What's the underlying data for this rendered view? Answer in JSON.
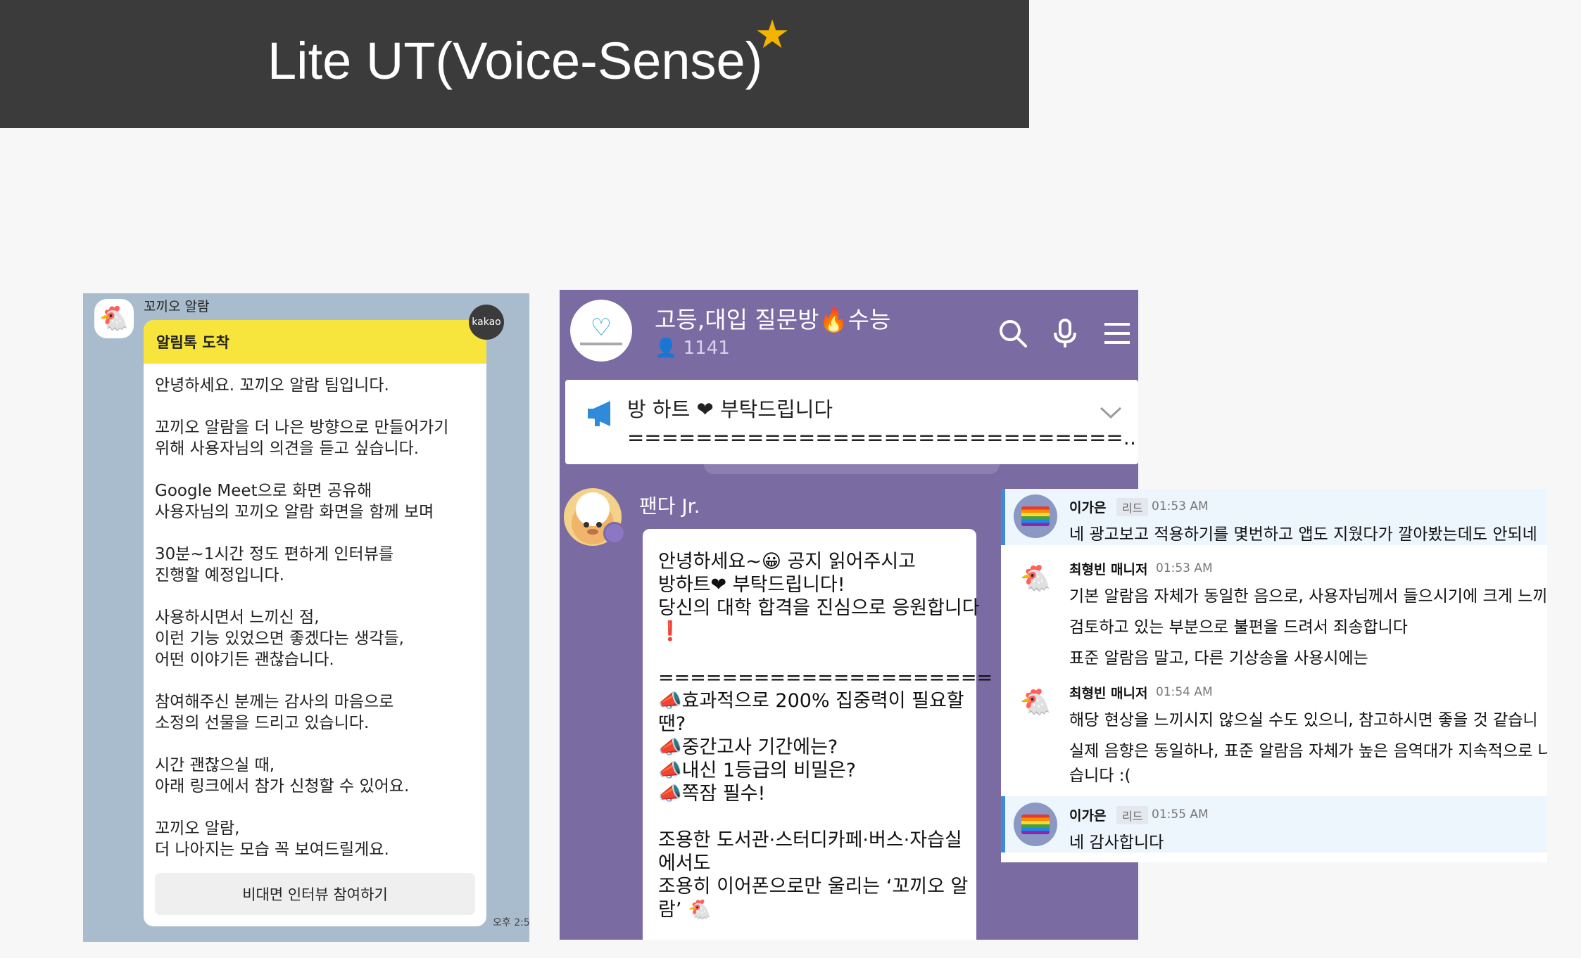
{
  "banner": {
    "title": "Lite UT(Voice-Sense)",
    "star": "★"
  },
  "kakao": {
    "sender": "꼬끼오 알람",
    "header": "알림톡 도착",
    "paragraphs": [
      [
        "안녕하세요. 꼬끼오 알람 팀입니다."
      ],
      [
        "꼬끼오 알람을 더 나은 방향으로 만들어가기",
        "위해 사용자님의 의견을 듣고 싶습니다."
      ],
      [
        "Google Meet으로 화면 공유해",
        "사용자님의 꼬끼오 알람 화면을 함께 보며"
      ],
      [
        "30분~1시간 정도 편하게 인터뷰를",
        "진행할 예정입니다."
      ],
      [
        "사용하시면서 느끼신 점,",
        "이런 기능 있었으면 좋겠다는 생각들,",
        "어떤 이야기든 괜찮습니다."
      ],
      [
        "참여해주신 분께는 감사의 마음으로",
        "소정의 선물을 드리고 있습니다."
      ],
      [
        "시간 괜찮으실 때,",
        "아래 링크에서 참가 신청할 수 있어요."
      ],
      [
        "꼬끼오 알람,",
        "더 나아지는 모습 꼭 보여드릴게요."
      ]
    ],
    "button": "비대면 인터뷰 참여하기",
    "badge": "kakao",
    "time": "오후 2:5"
  },
  "telegram": {
    "title": "고등,대입 질문방🔥수능",
    "member_count": "1141",
    "pinned_line1": "방 하트 ❤ 부탁드립니다",
    "pinned_line2": "=============================...",
    "sender": "팬다 Jr.",
    "message_lines": [
      "안녕하세요~😀  공지 읽어주시고",
      "방하트❤ 부탁드립니다!",
      "당신의 대학 합격을 진심으로 응원합니다",
      "❗",
      "",
      "=====================",
      "📣효과적으로 200% 집중력이 필요할",
      "땐?",
      "📣중간고사 기간에는?",
      "📣내신 1등급의 비밀은?",
      "📣쪽잠 필수!",
      "",
      "조용한 도서관·스터디카페·버스·자습실",
      "에서도",
      "조용히 이어폰으로만 울리는 ‘꼬끼오 알",
      "람’ 🐔"
    ]
  },
  "community": {
    "messages": [
      {
        "name": "이가은",
        "tag": "리드",
        "time": "01:53 AM",
        "lines": [
          "네 광고보고 적용하기를 몇번하고 앱도 지웠다가 깔아봤는데도 안되네"
        ]
      },
      {
        "name": "최형빈 매니저",
        "tag": "",
        "time": "01:53 AM",
        "lines": [
          "기본 알람음 자체가 동일한 음으로, 사용자님께서 들으시기에 크게 느끼",
          "검토하고 있는 부분으로 불편을 드려서 죄송합니다",
          "표준 알람음 말고, 다른 기상송을 사용시에는"
        ]
      },
      {
        "name": "최형빈 매니저",
        "tag": "",
        "time": "01:54 AM",
        "lines": [
          "해당 현상을 느끼시지 않으실 수도 있으니, 참고하시면 좋을 것 같습니",
          "실제 음향은 동일하나, 표준 알람음 자체가 높은 음역대가 지속적으로 나",
          "습니다 :("
        ]
      },
      {
        "name": "이가은",
        "tag": "리드",
        "time": "01:55 AM",
        "lines": [
          "네 감사합니다"
        ]
      }
    ]
  }
}
